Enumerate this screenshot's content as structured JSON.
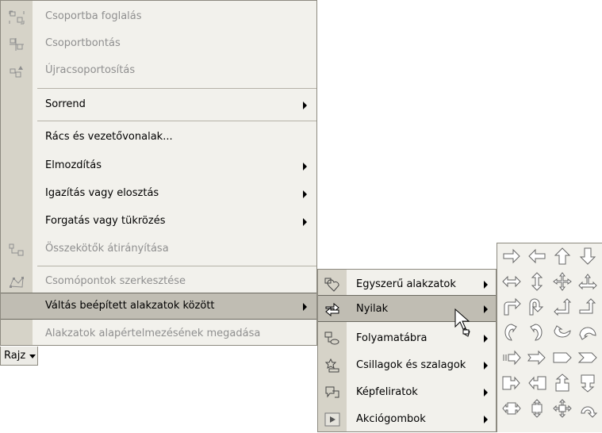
{
  "menu": {
    "items": [
      {
        "label": "Csoportba foglalás",
        "disabled": true,
        "icon": "group-icon",
        "submenu": false
      },
      {
        "label": "Csoportbontás",
        "disabled": true,
        "icon": "ungroup-icon",
        "submenu": false
      },
      {
        "label": "Újracsoportosítás",
        "disabled": true,
        "icon": "regroup-icon",
        "submenu": false
      },
      {
        "label": "Sorrend",
        "disabled": false,
        "icon": "",
        "submenu": true
      },
      {
        "label": "Rács és vezetővonalak...",
        "disabled": false,
        "icon": "",
        "submenu": false
      },
      {
        "label": "Elmozdítás",
        "disabled": false,
        "icon": "",
        "submenu": true
      },
      {
        "label": "Igazítás vagy elosztás",
        "disabled": false,
        "icon": "",
        "submenu": true
      },
      {
        "label": "Forgatás vagy tükrözés",
        "disabled": false,
        "icon": "",
        "submenu": true
      },
      {
        "label": "Összekötők átirányítása",
        "disabled": true,
        "icon": "reroute-connectors-icon",
        "submenu": false
      },
      {
        "label": "Csomópontok szerkesztése",
        "disabled": true,
        "icon": "edit-points-icon",
        "submenu": false
      },
      {
        "label": "Váltás beépített alakzatok között",
        "disabled": false,
        "icon": "",
        "submenu": true,
        "highlighted": true
      },
      {
        "label": "Alakzatok alapértelmezésének megadása",
        "disabled": true,
        "icon": "",
        "submenu": false
      }
    ]
  },
  "rajz_button": {
    "label": "Rajz"
  },
  "submenu": {
    "items": [
      {
        "label": "Egyszerű alakzatok",
        "icon": "basic-shapes-icon"
      },
      {
        "label": "Nyilak",
        "icon": "block-arrows-icon",
        "highlighted": true
      },
      {
        "label": "Folyamatábra",
        "icon": "flowchart-icon"
      },
      {
        "label": "Csillagok és szalagok",
        "icon": "stars-banners-icon"
      },
      {
        "label": "Képfeliratok",
        "icon": "callouts-icon"
      },
      {
        "label": "Akciógombok",
        "icon": "action-buttons-icon"
      }
    ]
  },
  "palette": {
    "rows": [
      [
        "right-arrow-icon",
        "left-arrow-icon",
        "up-arrow-icon",
        "down-arrow-icon"
      ],
      [
        "left-right-arrow-icon",
        "up-down-arrow-icon",
        "quad-arrow-icon",
        "left-right-up-arrow-icon"
      ],
      [
        "bent-arrow-icon",
        "u-turn-arrow-icon",
        "left-up-arrow-icon",
        "bent-up-arrow-icon"
      ],
      [
        "curved-right-arrow-icon",
        "curved-left-arrow-icon",
        "curved-up-arrow-icon",
        "curved-down-arrow-icon"
      ],
      [
        "striped-right-arrow-icon",
        "notched-right-arrow-icon",
        "pentagon-arrow-icon",
        "chevron-arrow-icon"
      ],
      [
        "right-arrow-callout-icon",
        "left-arrow-callout-icon",
        "up-arrow-callout-icon",
        "down-arrow-callout-icon"
      ],
      [
        "left-right-arrow-callout-icon",
        "up-down-arrow-callout-icon",
        "quad-arrow-callout-icon",
        "circular-arrow-icon"
      ]
    ]
  },
  "colors": {
    "menu_bg": "#f2f1ec",
    "icon_strip": "#d6d3c8",
    "highlight": "#c0bdb3",
    "disabled_text": "#8f8f8f"
  }
}
